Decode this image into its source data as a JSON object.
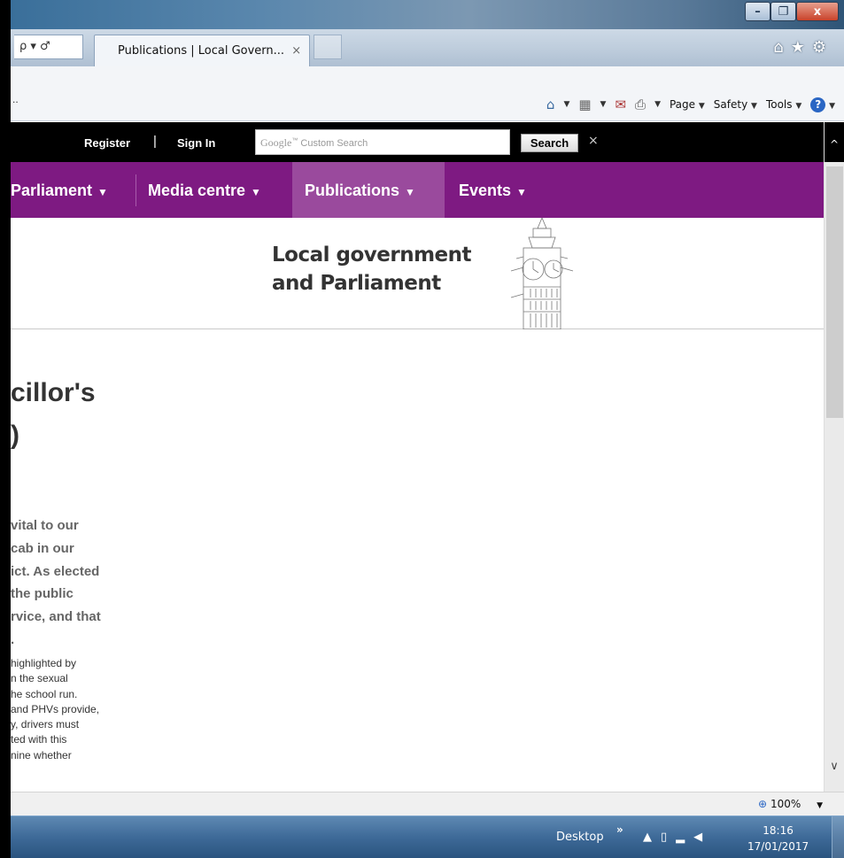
{
  "browser": {
    "address_tail": "ρ ▾ ♂",
    "tab_title": "Publications | Local Govern...",
    "tab_close": "×",
    "window_buttons": {
      "minimize": "–",
      "maximize": "❐",
      "close": "x"
    },
    "command_bar": {
      "page_label": "Page",
      "safety_label": "Safety",
      "tools_label": "Tools",
      "help_label": "?"
    },
    "zoom": "100%"
  },
  "site": {
    "register": "Register",
    "sign_in": "Sign In",
    "search_placeholder_brand": "Google",
    "search_placeholder_text": "Custom Search",
    "search_button": "Search",
    "search_clear": "×",
    "nav": [
      {
        "label": "Parliament"
      },
      {
        "label": "Media centre"
      },
      {
        "label": "Publications",
        "active": true
      },
      {
        "label": "Events"
      }
    ],
    "banner_line1": "Local government",
    "banner_line2": "and Parliament"
  },
  "article": {
    "title_line1": "cillor's",
    "title_line2": ")",
    "lead": [
      "vital to our",
      "cab in our",
      "ict. As elected",
      "the public",
      "rvice, and that",
      "."
    ],
    "body": [
      "highlighted by",
      "n the sexual",
      "he school run.",
      "and PHVs provide,",
      "y, drivers must",
      "ted with this",
      "nine whether"
    ]
  },
  "taskbar": {
    "desktop": "Desktop",
    "chevron": "»",
    "time": "18:16",
    "date": "17/01/2017"
  },
  "colors": {
    "nav_purple": "#7e1a82",
    "nav_active": "#9a4a9d",
    "topbar": "#000000"
  }
}
